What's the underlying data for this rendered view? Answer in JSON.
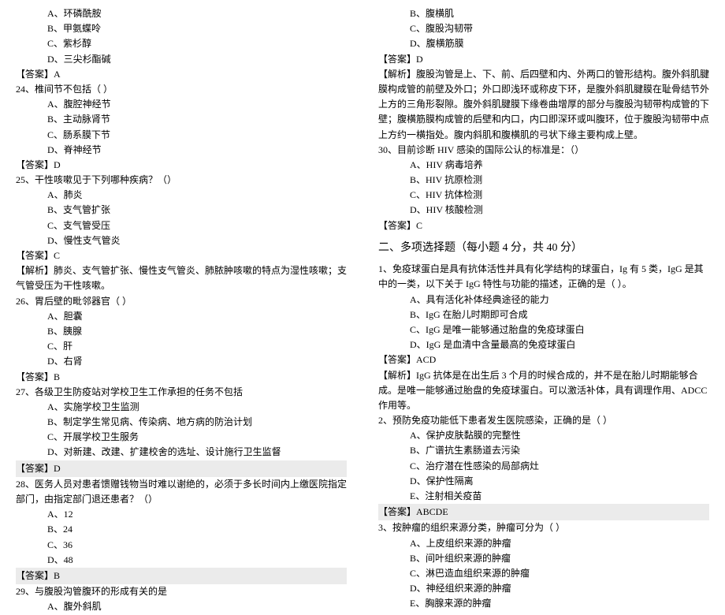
{
  "left": {
    "q23_opts": [
      "A、环磷酰胺",
      "B、甲氨蝶呤",
      "C、紫杉醇",
      "D、三尖杉酯碱"
    ],
    "q23_ans": "【答案】A",
    "q24": "24、椎间节不包括（ ）",
    "q24_opts": [
      "A、腹腔神经节",
      "B、主动脉肾节",
      "C、肠系膜下节",
      "D、脊神经节"
    ],
    "q24_ans": "【答案】D",
    "q25": "25、干性咳嗽见于下列哪种疾病？（）",
    "q25_opts": [
      "A、肺炎",
      "B、支气管扩张",
      "C、支气管受压",
      "D、慢性支气管炎"
    ],
    "q25_ans": "【答案】C",
    "q25_exp": "【解析】肺炎、支气管扩张、慢性支气管炎、肺脓肿咳嗽的特点为湿性咳嗽；支气管受压为干性咳嗽。",
    "q26": "26、胃后壁的毗邻器官（ ）",
    "q26_opts": [
      "A、胆囊",
      "B、胰腺",
      "C、肝",
      "D、右肾"
    ],
    "q26_ans": "【答案】B",
    "q27": "27、各级卫生防疫站对学校卫生工作承担的任务不包括",
    "q27_opts": [
      "A、实施学校卫生监测",
      "B、制定学生常见病、传染病、地方病的防治计划",
      "C、开展学校卫生服务",
      "D、对新建、改建、扩建校舍的选址、设计施行卫生监督"
    ],
    "q27_ans": "【答案】D",
    "q28": "28、医务人员对患者馈赠钱物当时难以谢绝的，必须于多长时间内上缴医院指定部门，由指定部门退还患者？（）",
    "q28_opts": [
      "A、12",
      "B、24",
      "C、36",
      "D、48"
    ],
    "q28_ans": "【答案】B",
    "q29": "29、与腹股沟管腹环的形成有关的是",
    "q29_opt_a": "A、腹外斜肌"
  },
  "right": {
    "q29_opts_rest": [
      "B、腹横肌",
      "C、腹股沟韧带",
      "D、腹横筋膜"
    ],
    "q29_ans": "【答案】D",
    "q29_exp": "【解析】腹股沟管是上、下、前、后四壁和内、外两口的管形结构。腹外斜肌腱膜构成管的前壁及外口；外口即浅环或称皮下环，是腹外斜肌腱膜在耻骨结节外上方的三角形裂隙。腹外斜肌腱膜下缘卷曲增厚的部分与腹股沟韧带构成管的下壁；腹横筋膜构成管的后壁和内口，内口即深环或叫腹环，位于腹股沟韧带中点上方约一横指处。腹内斜肌和腹横肌的弓状下缘主要构成上壁。",
    "q30": "30、目前诊断 HIV 感染的国际公认的标准是：（）",
    "q30_opts": [
      "A、HIV 病毒培养",
      "B、HIV 抗原检测",
      "C、HIV 抗体检测",
      "D、HIV 核酸检测"
    ],
    "q30_ans": "【答案】C",
    "section2": "二、多项选择题（每小题 4 分，共 40 分）",
    "mq1": "1、免疫球蛋白是具有抗体活性并具有化学结构的球蛋白，Ig 有 5 类，IgG 是其中的一类，以下关于 IgG 特性与功能的描述，正确的是（ ）。",
    "mq1_opts": [
      "A、具有活化补体经典途径的能力",
      "B、IgG 在胎儿时期即可合成",
      "C、IgG 是唯一能够通过胎盘的免疫球蛋白",
      "D、IgG 是血清中含量最高的免疫球蛋白"
    ],
    "mq1_ans": "【答案】ACD",
    "mq1_exp": "【解析】IgG 抗体是在出生后 3 个月的时候合成的，并不是在胎儿时期能够合成。是唯一能够通过胎盘的免疫球蛋白。可以激活补体，具有调理作用、ADCC 作用等。",
    "mq2": "2、预防免疫功能低下患者发生医院感染，正确的是（ ）",
    "mq2_opts": [
      "A、保护皮肤黏膜的完整性",
      "B、广谱抗生素肠道去污染",
      "C、治疗潜在性感染的局部病灶",
      "D、保护性隔离",
      "E、注射相关疫苗"
    ],
    "mq2_ans": "【答案】ABCDE",
    "mq3": "3、按肿瘤的组织来源分类，肿瘤可分为（ ）",
    "mq3_opts": [
      "A、上皮组织来源的肿瘤",
      "B、间叶组织来源的肿瘤",
      "C、淋巴造血组织来源的肿瘤",
      "D、神经组织来源的肿瘤",
      "E、胸腺来源的肿瘤"
    ]
  }
}
